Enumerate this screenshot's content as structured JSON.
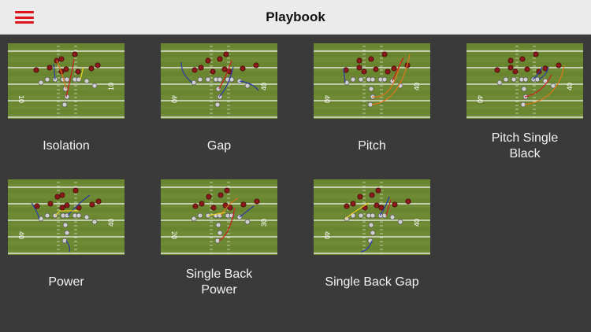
{
  "header": {
    "title": "Playbook",
    "menu_icon": "hamburger-menu-icon",
    "accent_color": "#e0141e"
  },
  "plays": [
    {
      "name": "Isolation",
      "line1": "Isolation",
      "line2": "",
      "yard_numbers": [
        "10",
        "10"
      ]
    },
    {
      "name": "Gap",
      "line1": "Gap",
      "line2": "",
      "yard_numbers": [
        "40",
        "40"
      ]
    },
    {
      "name": "Pitch",
      "line1": "Pitch",
      "line2": "",
      "yard_numbers": [
        "40",
        "40"
      ]
    },
    {
      "name": "Pitch Single Black",
      "line1": "Pitch Single",
      "line2": "Black",
      "yard_numbers": [
        "40",
        "40"
      ]
    },
    {
      "name": "Power",
      "line1": "Power",
      "line2": "",
      "yard_numbers": [
        "40",
        "40"
      ]
    },
    {
      "name": "Single Back Power",
      "line1": "Single Back",
      "line2": "Power",
      "yard_numbers": [
        "20",
        "30"
      ]
    },
    {
      "name": "Single Back Gap",
      "line1": "Single Back Gap",
      "line2": "",
      "yard_numbers": [
        "40",
        "40"
      ]
    }
  ],
  "colors": {
    "field": "#6f8a34",
    "field_dark": "#5e7a2a",
    "defense": "#8a1a1a",
    "offense": "#cfcfcf",
    "route_blue": "#2a3aa8",
    "route_orange": "#e07818",
    "route_yellow": "#e8d020",
    "route_red": "#c82020"
  }
}
